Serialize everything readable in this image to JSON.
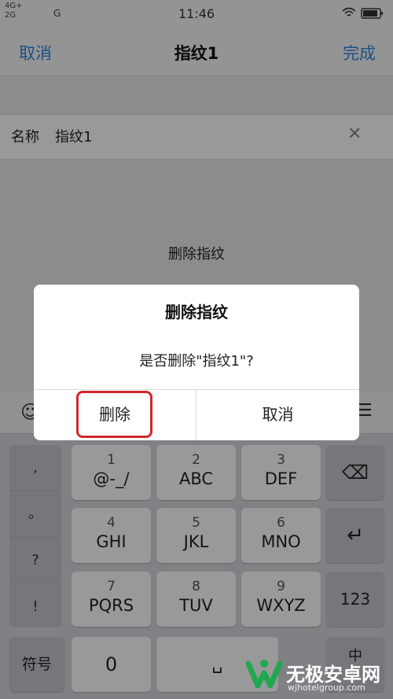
{
  "status": {
    "signal1": "4G+",
    "signal2": "2G",
    "carrier": "G",
    "time": "11:46"
  },
  "nav": {
    "cancel": "取消",
    "title": "指纹1",
    "done": "完成"
  },
  "form": {
    "name_label": "名称",
    "name_value": "指纹1",
    "clear": "✕",
    "delete_action": "删除指纹"
  },
  "dialog": {
    "title": "删除指纹",
    "message": "是否删除\"指纹1\"?",
    "delete": "删除",
    "cancel": "取消"
  },
  "keyboard": {
    "punct": [
      ",",
      "。",
      "?",
      "!"
    ],
    "rows": [
      [
        {
          "num": "1",
          "letters": "@-_/"
        },
        {
          "num": "2",
          "letters": "ABC"
        },
        {
          "num": "3",
          "letters": "DEF"
        }
      ],
      [
        {
          "num": "4",
          "letters": "GHI"
        },
        {
          "num": "5",
          "letters": "JKL"
        },
        {
          "num": "6",
          "letters": "MNO"
        }
      ],
      [
        {
          "num": "7",
          "letters": "PQRS"
        },
        {
          "num": "8",
          "letters": "TUV"
        },
        {
          "num": "9",
          "letters": "WXYZ"
        }
      ]
    ],
    "symbols": "符号",
    "zero": "0",
    "space": "␣",
    "num_switch": "123",
    "lang": "中"
  },
  "watermark": {
    "name": "无极安卓网",
    "url": "wjhotelgroup.com"
  }
}
